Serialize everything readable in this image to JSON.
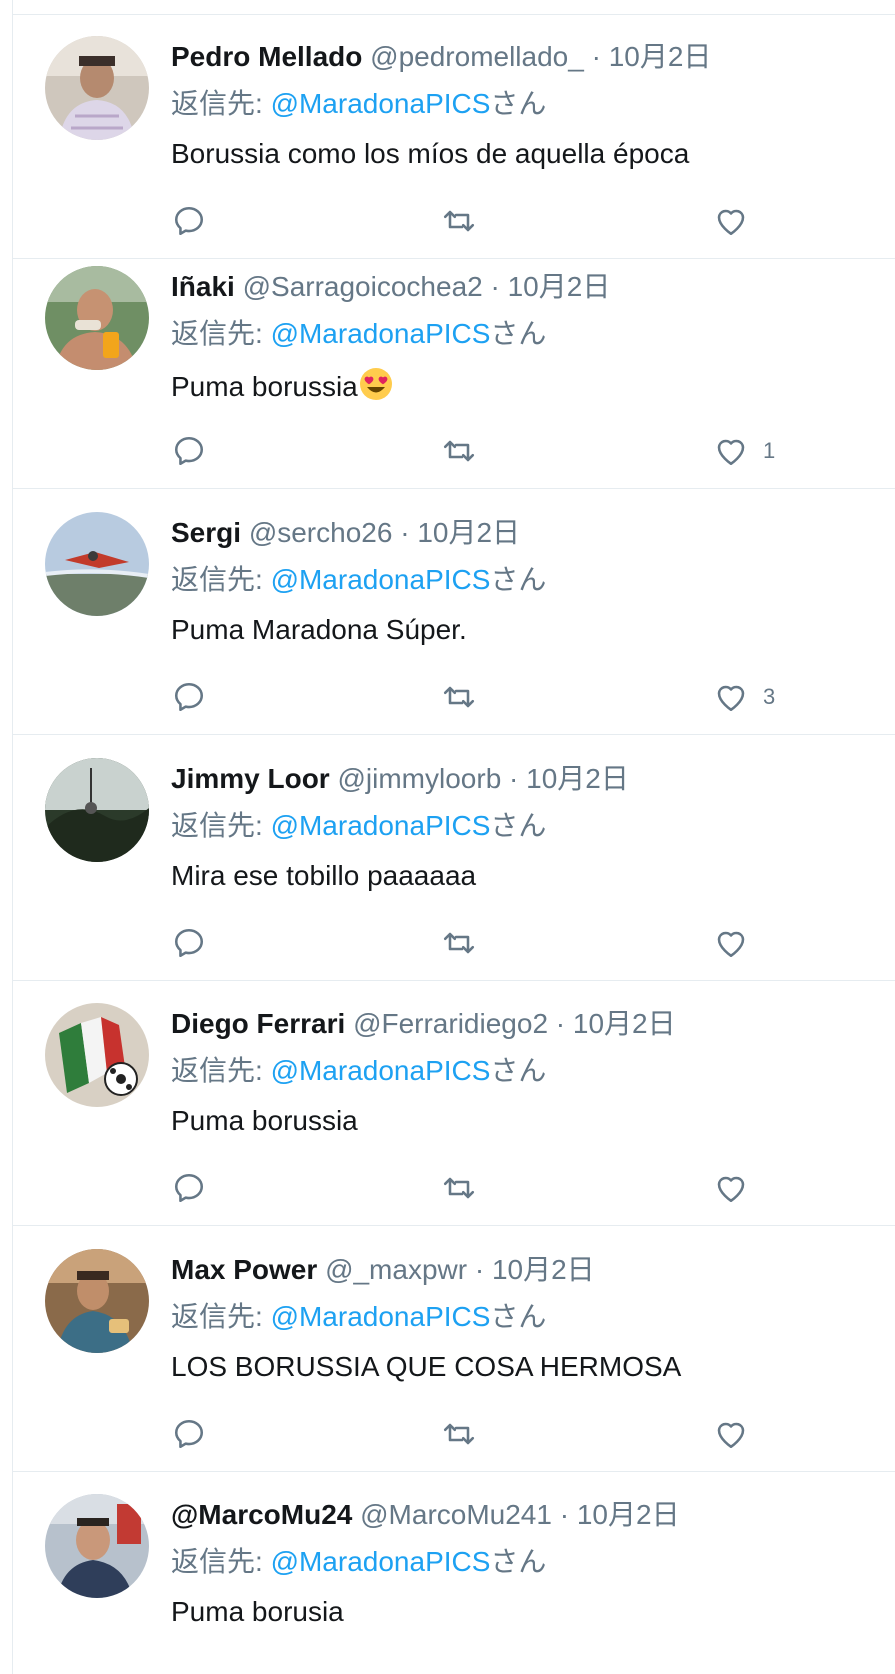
{
  "colors": {
    "link": "#1da1f2",
    "muted": "#657786",
    "text": "#14171a",
    "border": "#e6ecf0"
  },
  "reply_to_prefix": "返信先: ",
  "tweets": [
    {
      "name": "Pedro Mellado",
      "handle": "@pedromellado_",
      "separator": "·",
      "date": "10月2日",
      "reply_mention": "@MaradonaPICS",
      "reply_suffix": "さん",
      "text": "Borussia como los míos de aquella época",
      "like_count": ""
    },
    {
      "name": "Iñaki",
      "handle": "@Sarragoicochea2",
      "separator": "·",
      "date": "10月2日",
      "reply_mention": "@MaradonaPICS",
      "reply_suffix": "さん",
      "text": "Puma borussia",
      "emoji": "heart-eyes-emoji",
      "like_count": "1"
    },
    {
      "name": "Sergi",
      "handle": "@sercho26",
      "separator": "·",
      "date": "10月2日",
      "reply_mention": "@MaradonaPICS",
      "reply_suffix": "さん",
      "text": "Puma Maradona Súper.",
      "like_count": "3"
    },
    {
      "name": "Jimmy Loor",
      "handle": "@jimmyloorb",
      "separator": "·",
      "date": "10月2日",
      "reply_mention": "@MaradonaPICS",
      "reply_suffix": "さん",
      "text": "Mira ese tobillo paaaaaa",
      "like_count": ""
    },
    {
      "name": "Diego Ferrari",
      "handle": "@Ferraridiego2",
      "separator": "·",
      "date": "10月2日",
      "reply_mention": "@MaradonaPICS",
      "reply_suffix": "さん",
      "text": "Puma borussia",
      "like_count": ""
    },
    {
      "name": "Max Power",
      "handle": "@_maxpwr",
      "separator": "·",
      "date": "10月2日",
      "reply_mention": "@MaradonaPICS",
      "reply_suffix": "さん",
      "text": "LOS BORUSSIA QUE COSA HERMOSA",
      "like_count": ""
    },
    {
      "name": "@MarcoMu24",
      "handle": "@MarcoMu241",
      "separator": "·",
      "date": "10月2日",
      "reply_mention": "@MaradonaPICS",
      "reply_suffix": "さん",
      "text": "Puma borusia",
      "like_count": ""
    }
  ],
  "icons": {
    "reply": "reply-icon",
    "retweet": "retweet-icon",
    "like": "like-icon"
  }
}
